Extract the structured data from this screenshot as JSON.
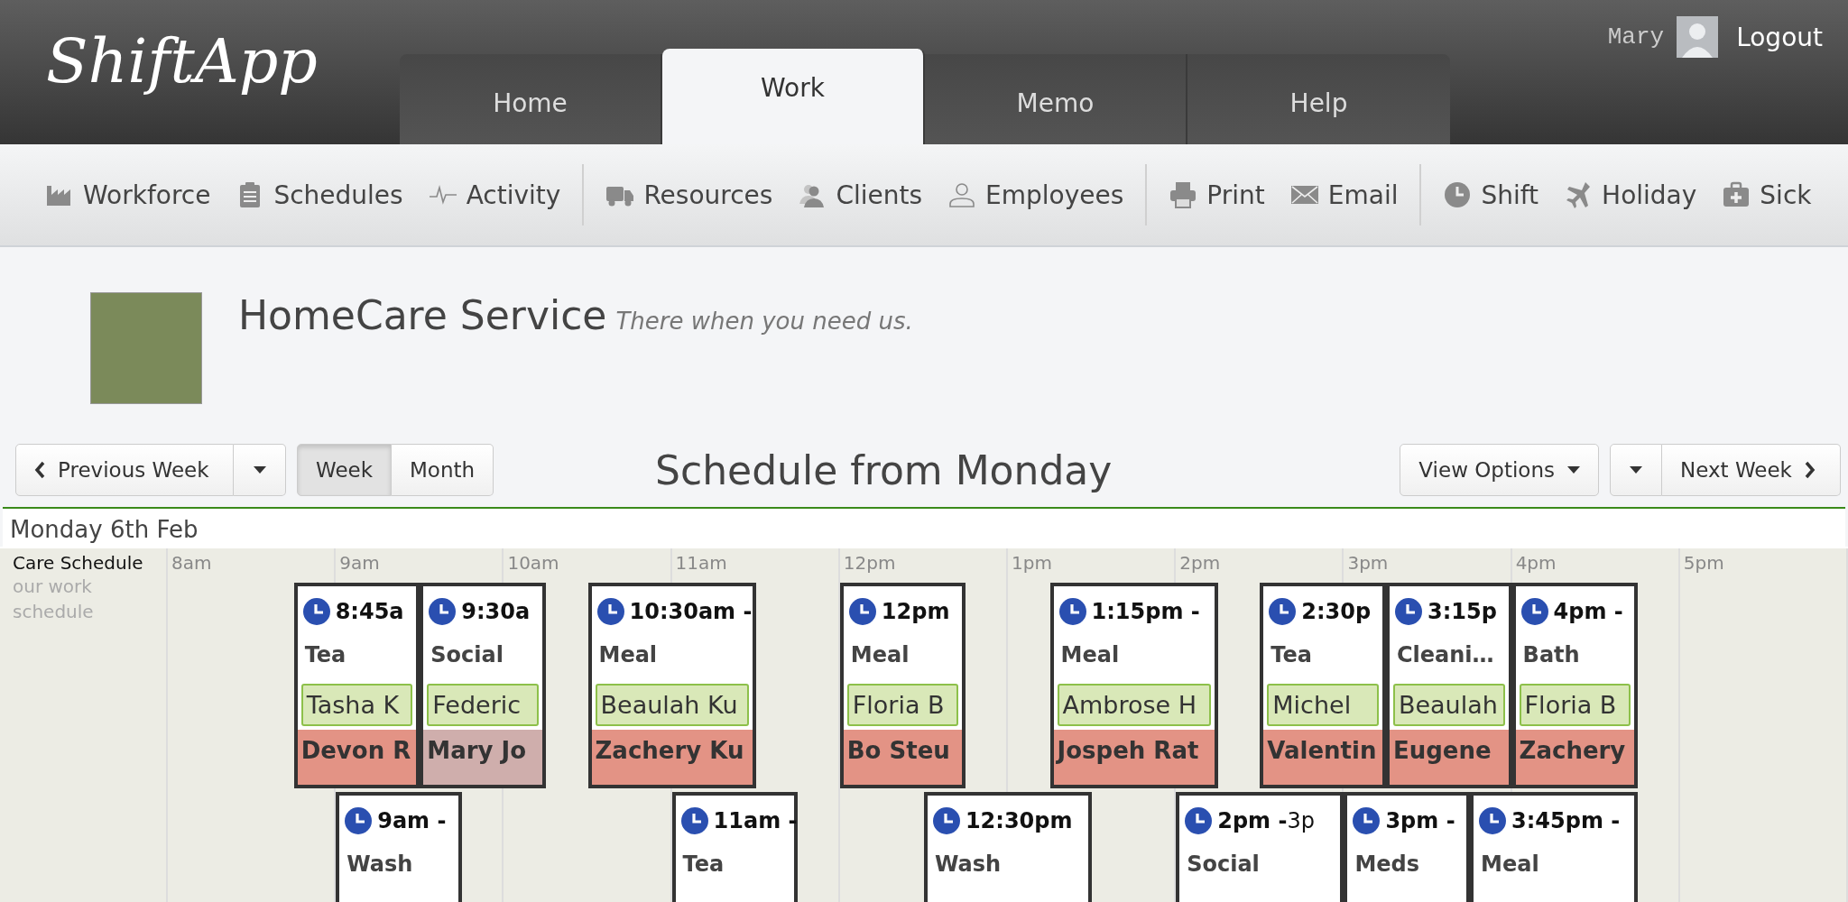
{
  "header": {
    "logo": "ShiftApp",
    "tabs": [
      {
        "label": "Home",
        "selected": false
      },
      {
        "label": "Work",
        "selected": true
      },
      {
        "label": "Memo",
        "selected": false
      },
      {
        "label": "Help",
        "selected": false
      }
    ],
    "user": {
      "name": "Mary",
      "logout": "Logout"
    }
  },
  "toolbar": {
    "groups": [
      [
        "Workforce",
        "Schedules",
        "Activity"
      ],
      [
        "Resources",
        "Clients",
        "Employees"
      ],
      [
        "Print",
        "Email"
      ],
      [
        "Shift",
        "Holiday",
        "Sick"
      ]
    ]
  },
  "company": {
    "name": "HomeCare Service",
    "tagline": "There when you need us."
  },
  "controls": {
    "previous": "Previous Week",
    "views": [
      {
        "label": "Week",
        "selected": true
      },
      {
        "label": "Month",
        "selected": false
      }
    ],
    "title": "Schedule from Monday",
    "view_options": "View Options",
    "next": "Next Week"
  },
  "schedule": {
    "date": "Monday 6th Feb",
    "name": "Care Schedule",
    "description": "our work schedule",
    "hours": [
      "8am",
      "9am",
      "10am",
      "11am",
      "12pm",
      "1pm",
      "2pm",
      "3pm",
      "4pm",
      "5pm"
    ],
    "shifts": [
      {
        "time": "8:45a",
        "task": "Tea",
        "client": "Tasha K",
        "employee": "Devon R",
        "color": "#e39385"
      },
      {
        "time": "9:30a",
        "task": "Social",
        "client": "Federic",
        "employee": "Mary Jo",
        "color": "#cfaeac"
      },
      {
        "time": "10:30am -",
        "task": "Meal",
        "client": "Beaulah Ku",
        "employee": "Zachery Ku",
        "color": "#e39385"
      },
      {
        "time": "12pm",
        "task": "Meal",
        "client": "Floria B",
        "employee": "Bo Steu",
        "color": "#e39385"
      },
      {
        "time": "1:15pm -",
        "task": "Meal",
        "client": "Ambrose H",
        "employee": "Jospeh Rat",
        "color": "#e39385"
      },
      {
        "time": "2:30p",
        "task": "Tea",
        "client": "Michel",
        "employee": "Valentin",
        "color": "#e39385"
      },
      {
        "time": "3:15p",
        "task": "Cleani…",
        "client": "Beaulah",
        "employee": "Eugene",
        "color": "#e39385"
      },
      {
        "time": "4pm -",
        "task": "Bath",
        "client": "Floria B",
        "employee": "Zachery",
        "color": "#e39385"
      },
      {
        "time": "9am -",
        "task": "Wash"
      },
      {
        "time": "11am -",
        "task": "Tea"
      },
      {
        "time": "12:30pm",
        "task": "Wash"
      },
      {
        "time": "2pm -",
        "end_time": "3p",
        "task": "Social"
      },
      {
        "time": "3pm -",
        "task": "Meds"
      },
      {
        "time": "3:45pm -",
        "task": "Meal"
      }
    ]
  }
}
